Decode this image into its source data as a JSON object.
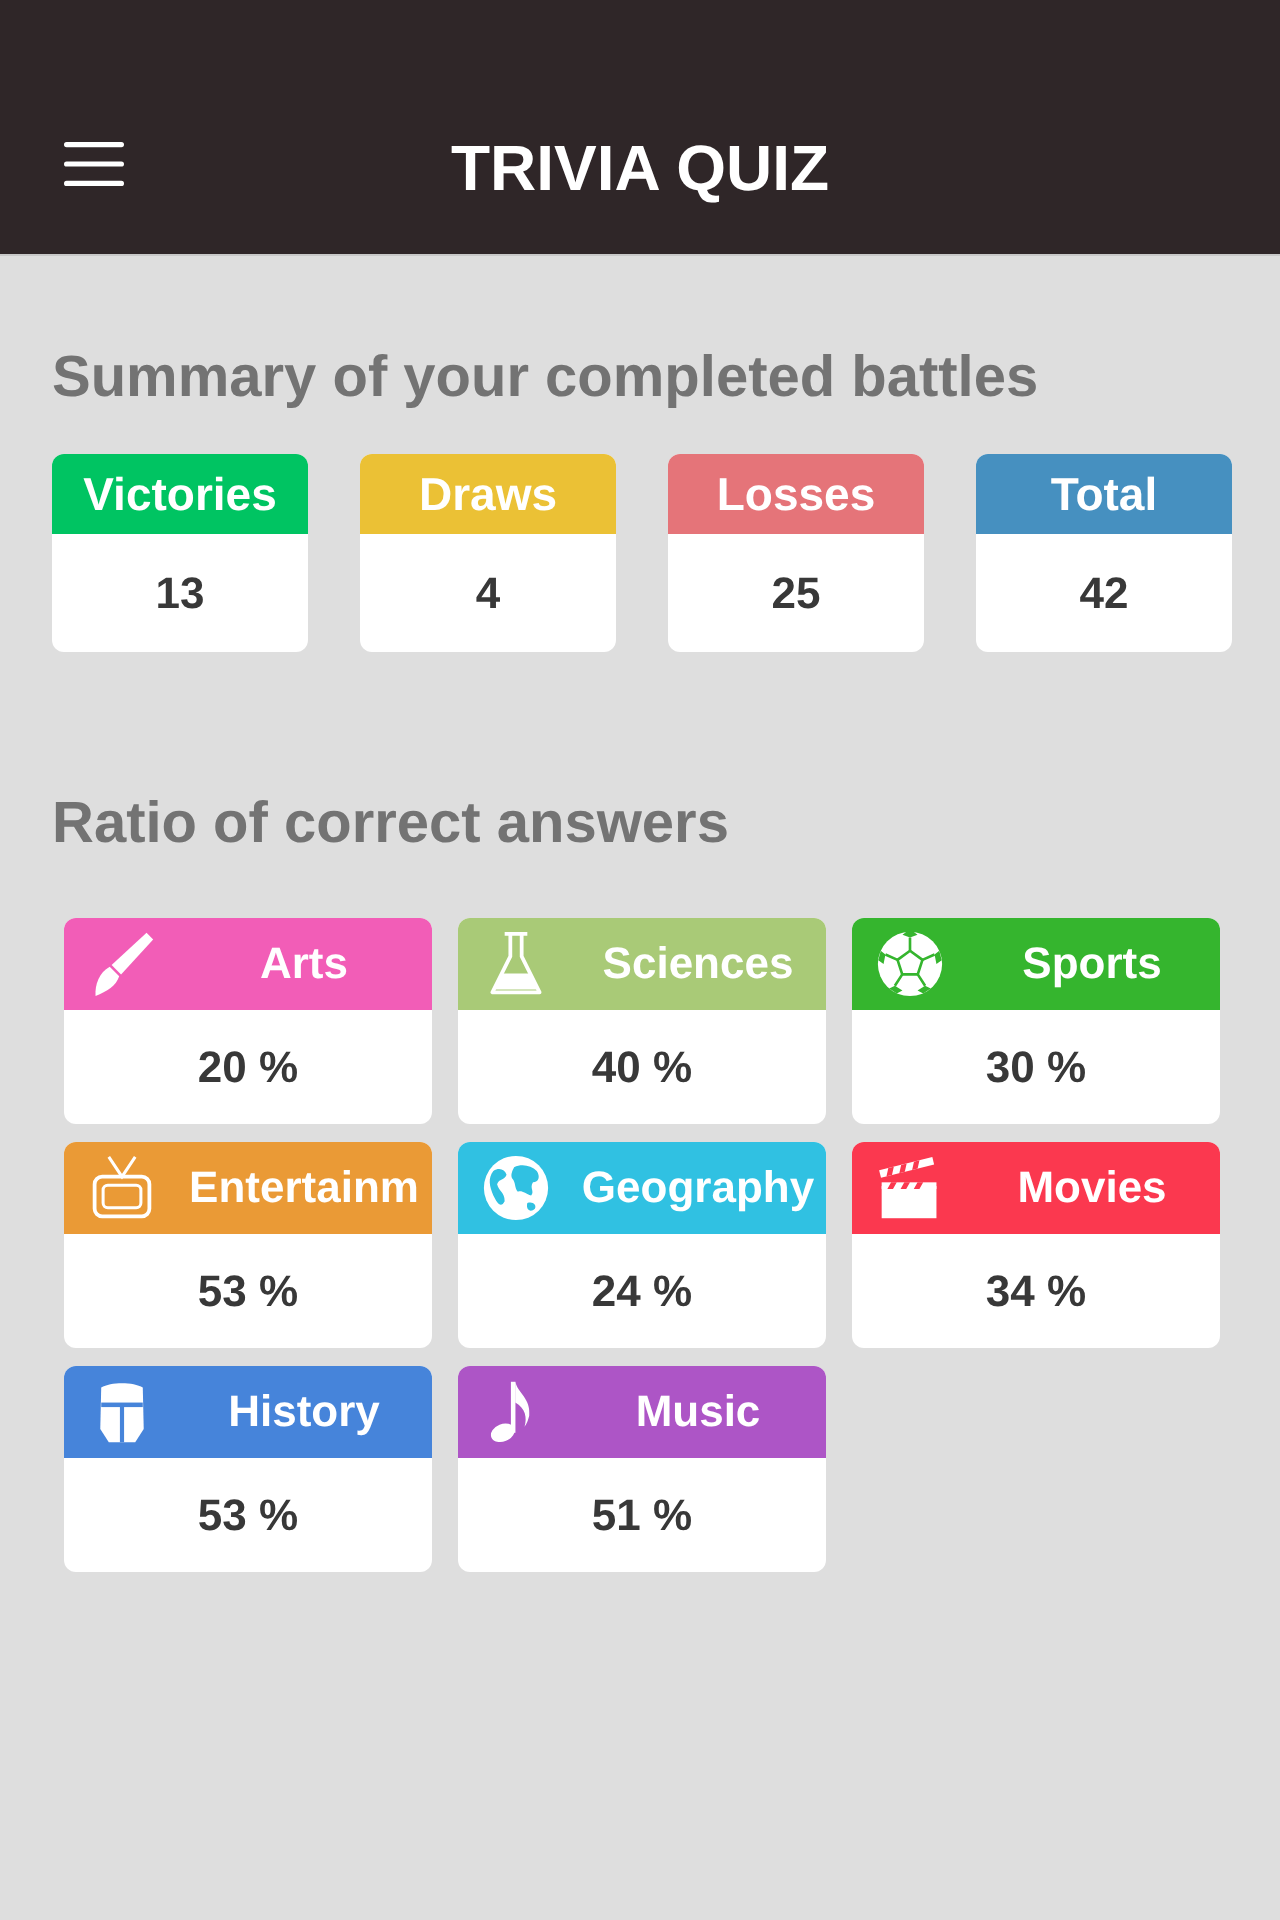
{
  "header": {
    "title": "TRIVIA QUIZ"
  },
  "summary": {
    "heading": "Summary of your completed battles",
    "stats": [
      {
        "label": "Victories",
        "value": "13",
        "color": "#00c462"
      },
      {
        "label": "Draws",
        "value": "4",
        "color": "#ebc135"
      },
      {
        "label": "Losses",
        "value": "25",
        "color": "#e57479"
      },
      {
        "label": "Total",
        "value": "42",
        "color": "#4690c0"
      }
    ]
  },
  "ratios": {
    "heading": "Ratio of correct answers",
    "categories": [
      {
        "label": "Arts",
        "value": "20 %",
        "kind": "brush",
        "color": "#f25db7"
      },
      {
        "label": "Sciences",
        "value": "40 %",
        "kind": "flask",
        "color": "#a9ca77"
      },
      {
        "label": "Sports",
        "value": "30 %",
        "kind": "ball",
        "color": "#35b52e"
      },
      {
        "label": "Entertainm",
        "value": "53 %",
        "kind": "tv",
        "color": "#ea9a36"
      },
      {
        "label": "Geography",
        "value": "24 %",
        "kind": "globe",
        "color": "#30c1e2"
      },
      {
        "label": "Movies",
        "value": "34 %",
        "kind": "clapper",
        "color": "#fb384f"
      },
      {
        "label": "History",
        "value": "53 %",
        "kind": "helmet",
        "color": "#4684da"
      },
      {
        "label": "Music",
        "value": "51 %",
        "kind": "note",
        "color": "#ad55c6"
      }
    ]
  }
}
